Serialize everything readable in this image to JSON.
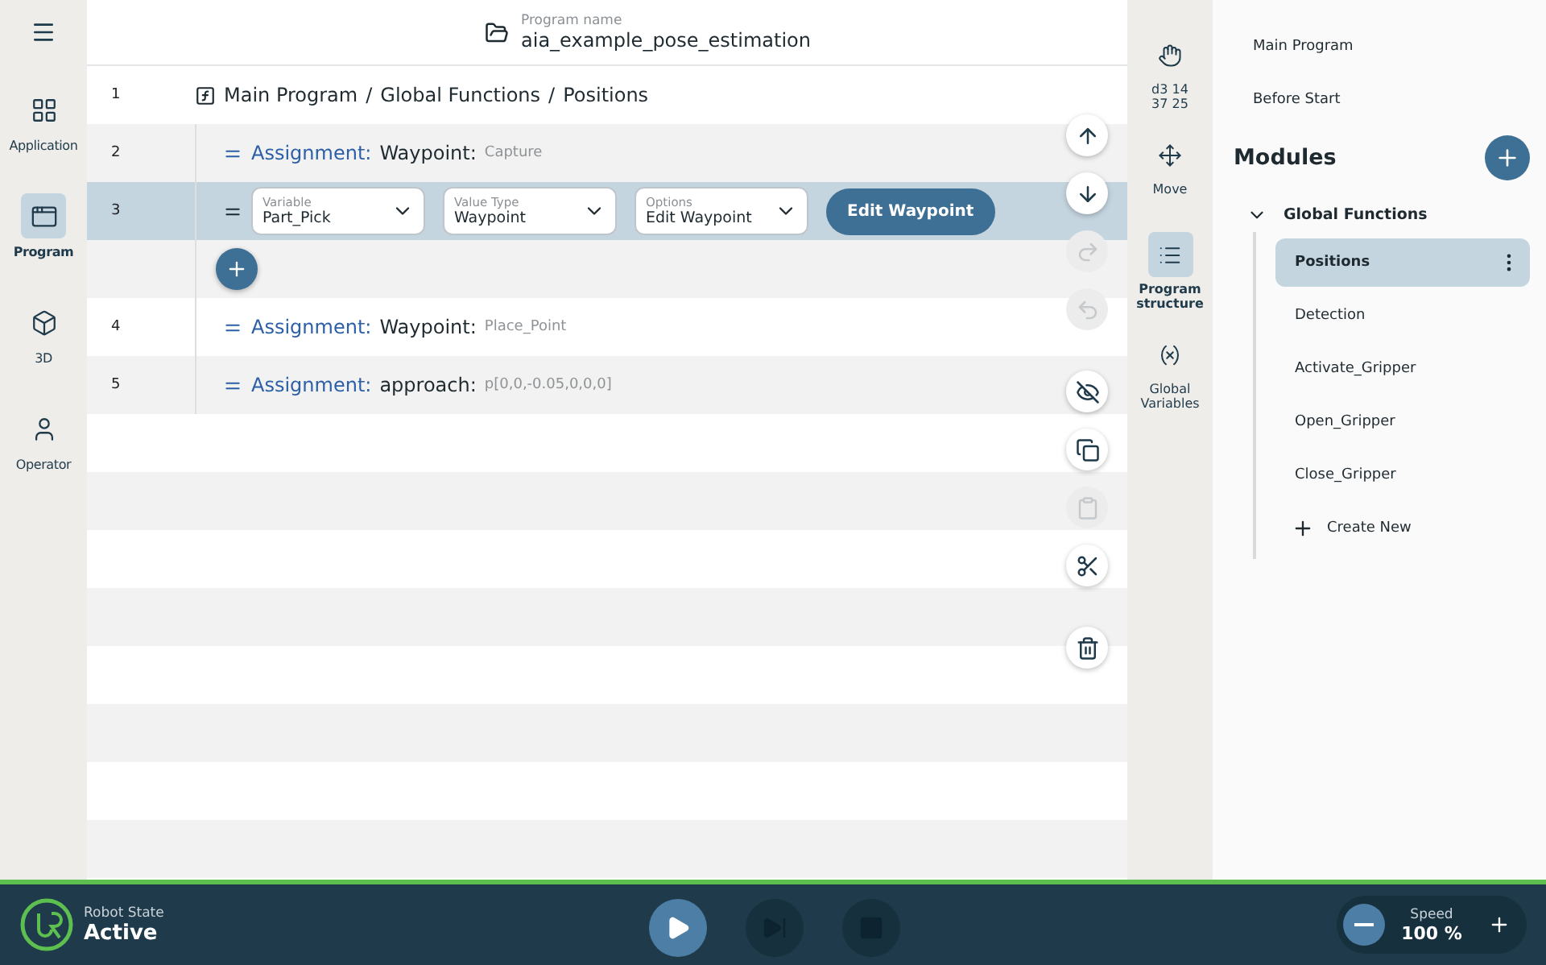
{
  "left_nav": [
    {
      "kind": "application",
      "label": "Application",
      "selected": false
    },
    {
      "kind": "program",
      "label": "Program",
      "selected": true
    },
    {
      "kind": "cube",
      "label": "3D",
      "selected": false
    },
    {
      "kind": "operator",
      "label": "Operator",
      "selected": false
    }
  ],
  "header": {
    "label": "Program name",
    "value": "aia_example_pose_estimation"
  },
  "breadcrumb": {
    "line": "1",
    "separator": "/",
    "parts": [
      "Main Program",
      "Global Functions",
      "Positions"
    ]
  },
  "rows": [
    {
      "kind": "assignment",
      "line": "2",
      "keyword": "Assignment:",
      "name": "Waypoint:",
      "value": "Capture",
      "selected": false
    },
    {
      "kind": "editor",
      "line": "3",
      "selected": true,
      "fields": [
        {
          "label": "Variable",
          "value": "Part_Pick"
        },
        {
          "label": "Value Type",
          "value": "Waypoint"
        },
        {
          "label": "Options",
          "value": "Edit Waypoint"
        }
      ],
      "button": "Edit Waypoint"
    },
    {
      "kind": "add",
      "selected": false
    },
    {
      "kind": "assignment",
      "line": "4",
      "keyword": "Assignment:",
      "name": "Waypoint:",
      "value": "Place_Point",
      "selected": false
    },
    {
      "kind": "assignment",
      "line": "5",
      "keyword": "Assignment:",
      "name": "approach:",
      "value": "p[0,0,-0.05,0,0,0]",
      "selected": false
    }
  ],
  "actions": [
    {
      "kind": "up",
      "disabled": false
    },
    {
      "kind": "down",
      "disabled": false
    },
    {
      "kind": "redo",
      "disabled": true
    },
    {
      "kind": "undo",
      "disabled": true
    },
    {
      "kind": "hide",
      "disabled": false
    },
    {
      "kind": "copy",
      "disabled": false
    },
    {
      "kind": "paste",
      "disabled": true
    },
    {
      "kind": "cut",
      "disabled": false
    },
    {
      "kind": "delete",
      "disabled": false
    }
  ],
  "right_nav": [
    {
      "kind": "hand",
      "lines": [
        "d3 14",
        "37 25"
      ],
      "selected": false
    },
    {
      "kind": "move",
      "lines": [
        "Move"
      ],
      "selected": false
    },
    {
      "kind": "structure",
      "lines": [
        "Program",
        "structure"
      ],
      "selected": true
    },
    {
      "kind": "variables",
      "lines": [
        "Global",
        "Variables"
      ],
      "selected": false
    }
  ],
  "side_panel": {
    "top_items": [
      "Main Program",
      "Before Start"
    ],
    "title": "Modules",
    "tree": [
      {
        "label": "Global Functions",
        "expanded": true,
        "children": [
          {
            "label": "Positions",
            "selected": true
          },
          {
            "label": "Detection",
            "selected": false
          },
          {
            "label": "Activate_Gripper",
            "selected": false
          },
          {
            "label": "Open_Gripper",
            "selected": false
          },
          {
            "label": "Close_Gripper",
            "selected": false
          }
        ]
      }
    ],
    "create_new": "Create New"
  },
  "footer": {
    "state_label": "Robot State",
    "state": "Active",
    "controls": [
      {
        "kind": "play",
        "disabled": false
      },
      {
        "kind": "step",
        "disabled": true
      },
      {
        "kind": "stop",
        "disabled": true
      }
    ],
    "speed_label": "Speed",
    "speed": "100 %"
  }
}
